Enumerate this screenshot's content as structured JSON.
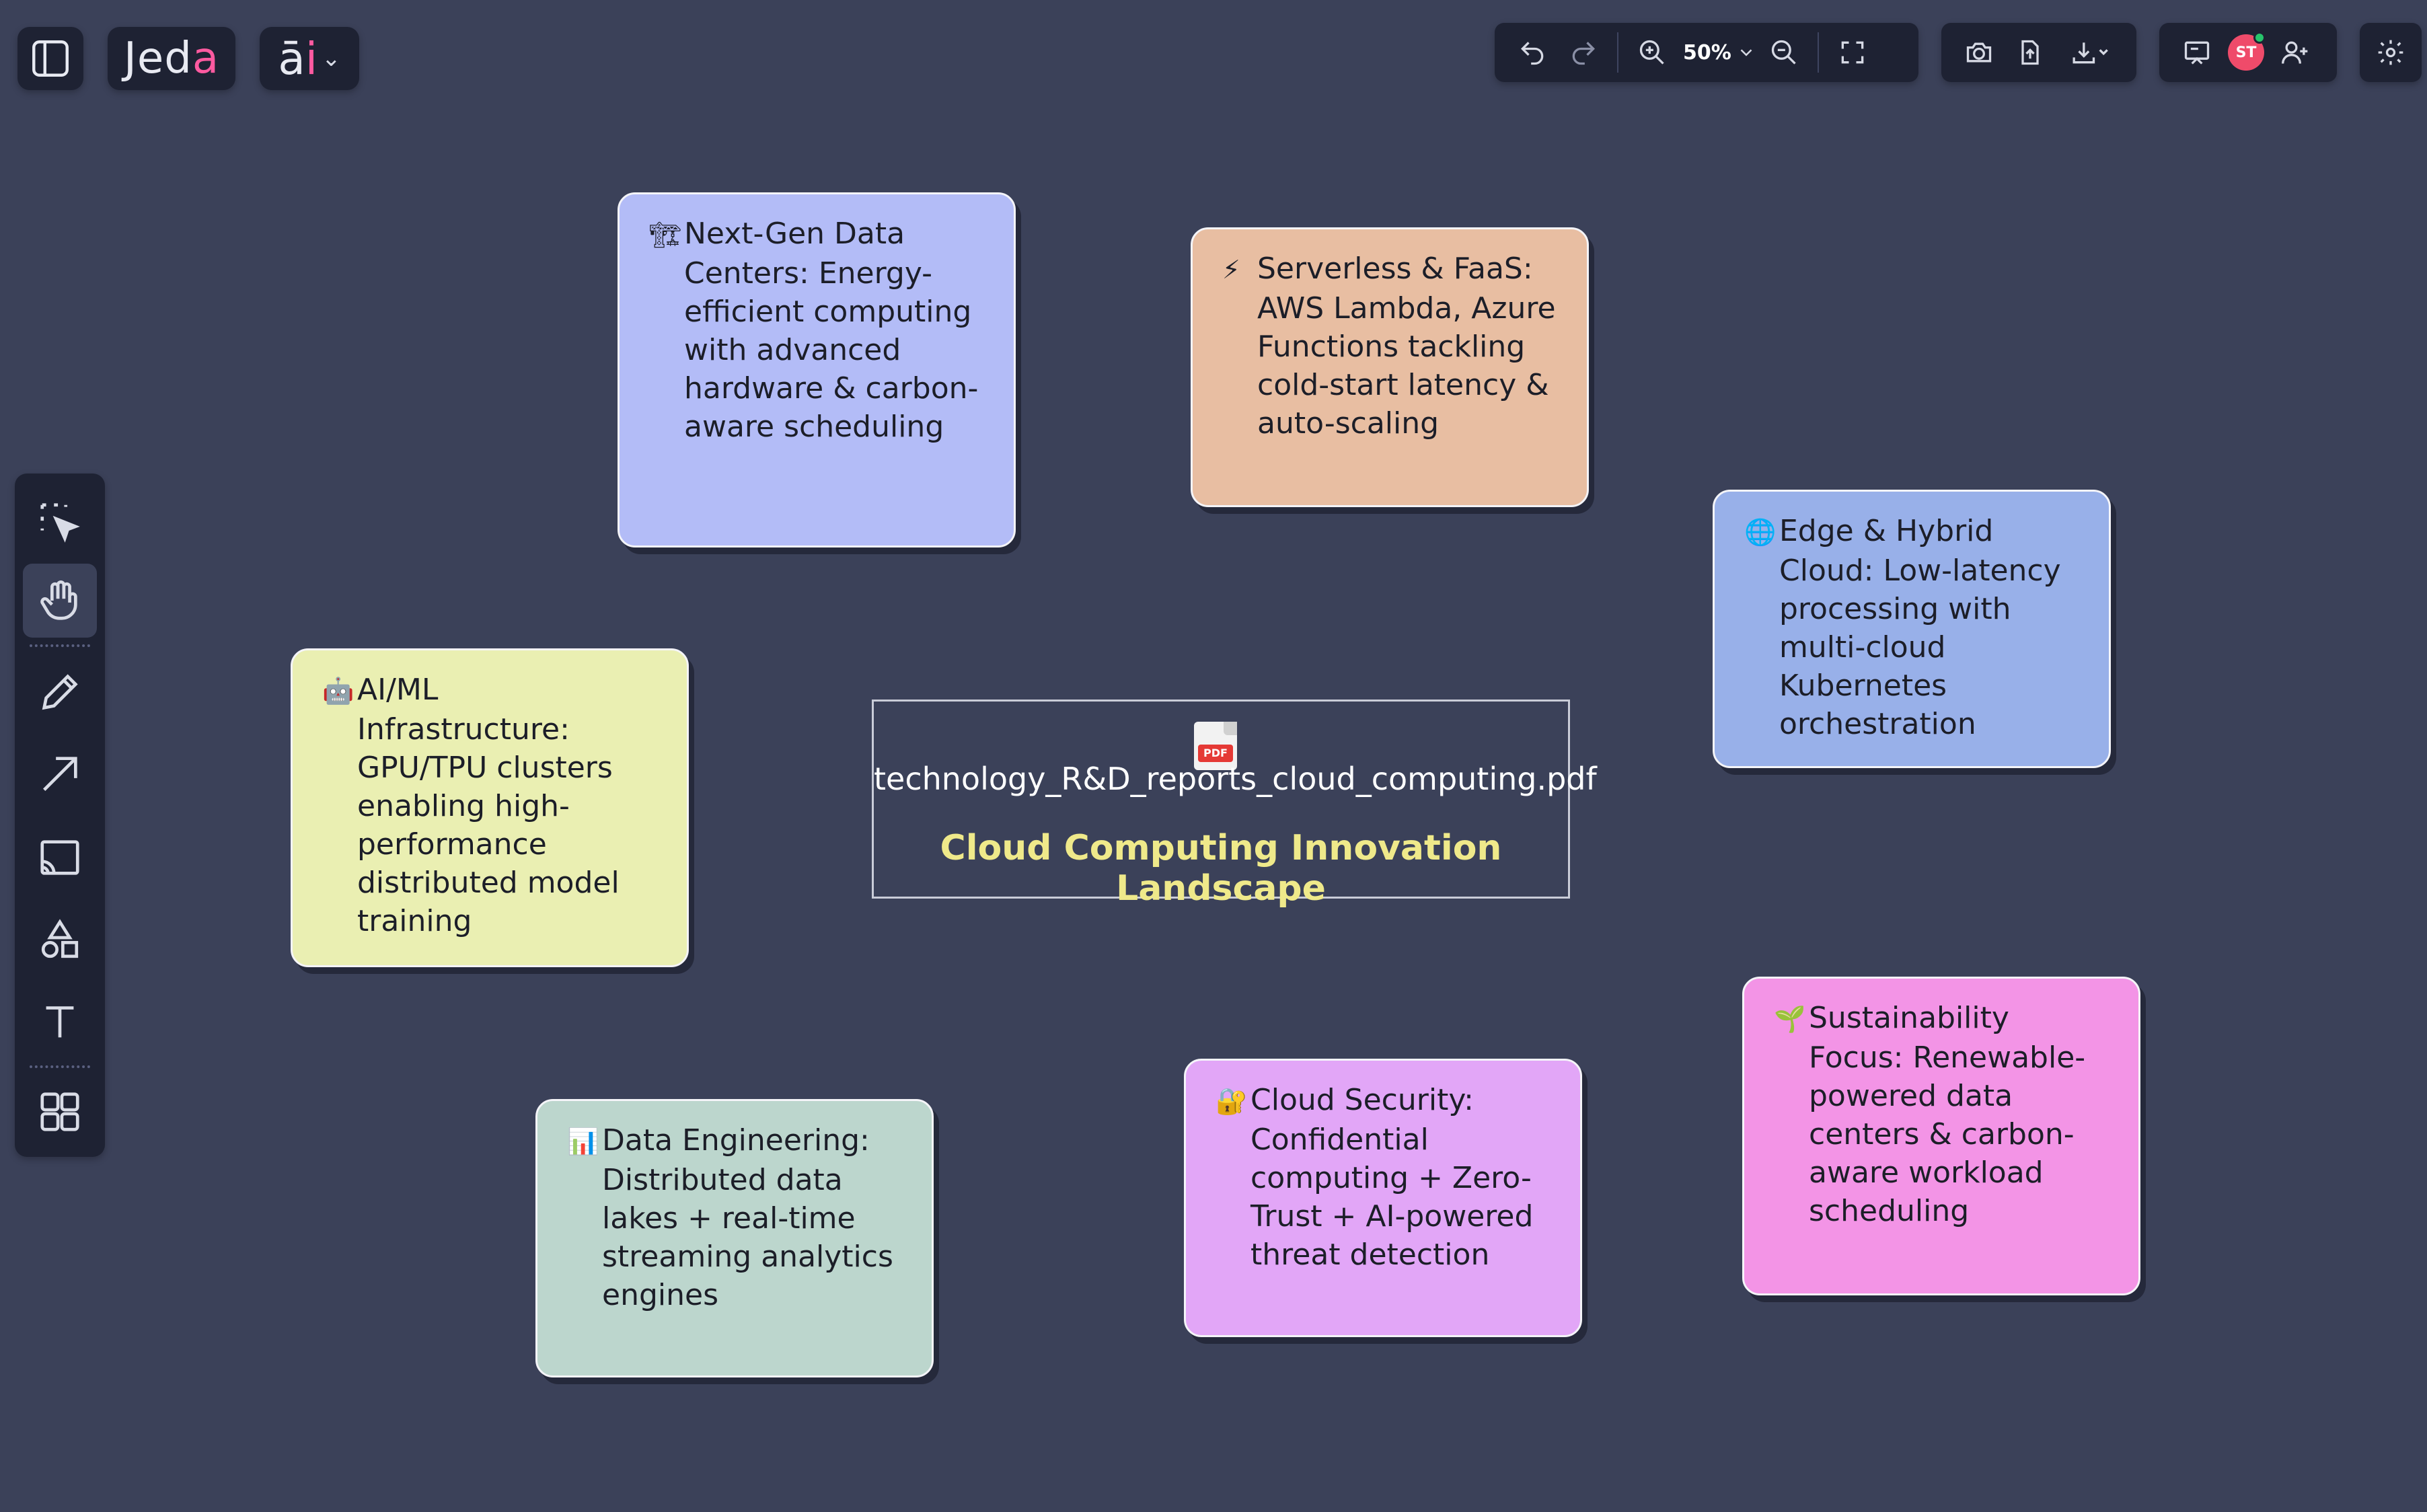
{
  "app": {
    "brand_prefix": "Jed",
    "brand_accent": "a",
    "ai_prefix": "ā",
    "ai_accent": "i"
  },
  "toolbar": {
    "zoom_level": "50%",
    "avatar_initials": "ST"
  },
  "canvas": {
    "file_card": {
      "filename": "technology_R&D_reports_cloud_computing.pdf",
      "title": "Cloud Computing Innovation Landscape",
      "badge": "PDF"
    },
    "notes": [
      {
        "id": "next-gen-data-centers",
        "emoji": "🏗",
        "text": "Next-Gen Data Centers: Energy-efficient computing with advanced hardware & carbon-aware scheduling",
        "color": "#b3bcf7"
      },
      {
        "id": "serverless-faas",
        "emoji": "⚡",
        "text": "Serverless & FaaS: AWS Lambda, Azure Functions tackling cold-start latency & auto-scaling",
        "color": "#e8bea2"
      },
      {
        "id": "edge-hybrid-cloud",
        "emoji": "🌐",
        "text": "Edge & Hybrid Cloud: Low-latency processing with multi-cloud Kubernetes orchestration",
        "color": "#98b0e9"
      },
      {
        "id": "ai-ml-infrastructure",
        "emoji": "🤖",
        "text": "AI/ML Infrastructure: GPU/TPU clusters enabling high-performance distributed model training",
        "color": "#eaefb2"
      },
      {
        "id": "data-engineering",
        "emoji": "📊",
        "text": "Data Engineering: Distributed data lakes + real-time streaming analytics engines",
        "color": "#bcd6cd"
      },
      {
        "id": "cloud-security",
        "emoji": "🔐",
        "text": "Cloud Security: Confidential computing + Zero-Trust + AI-powered threat detection",
        "color": "#e2a6f7"
      },
      {
        "id": "sustainability-focus",
        "emoji": "🌱",
        "text": "Sustainability Focus: Renewable-powered data centers & carbon-aware workload scheduling",
        "color": "#f394e6"
      }
    ]
  },
  "colors": {
    "canvas_bg": "#3b4159",
    "panel_bg": "#1e2233",
    "accent_pink": "#ff5aa0",
    "title_yellow": "#efe98a"
  }
}
